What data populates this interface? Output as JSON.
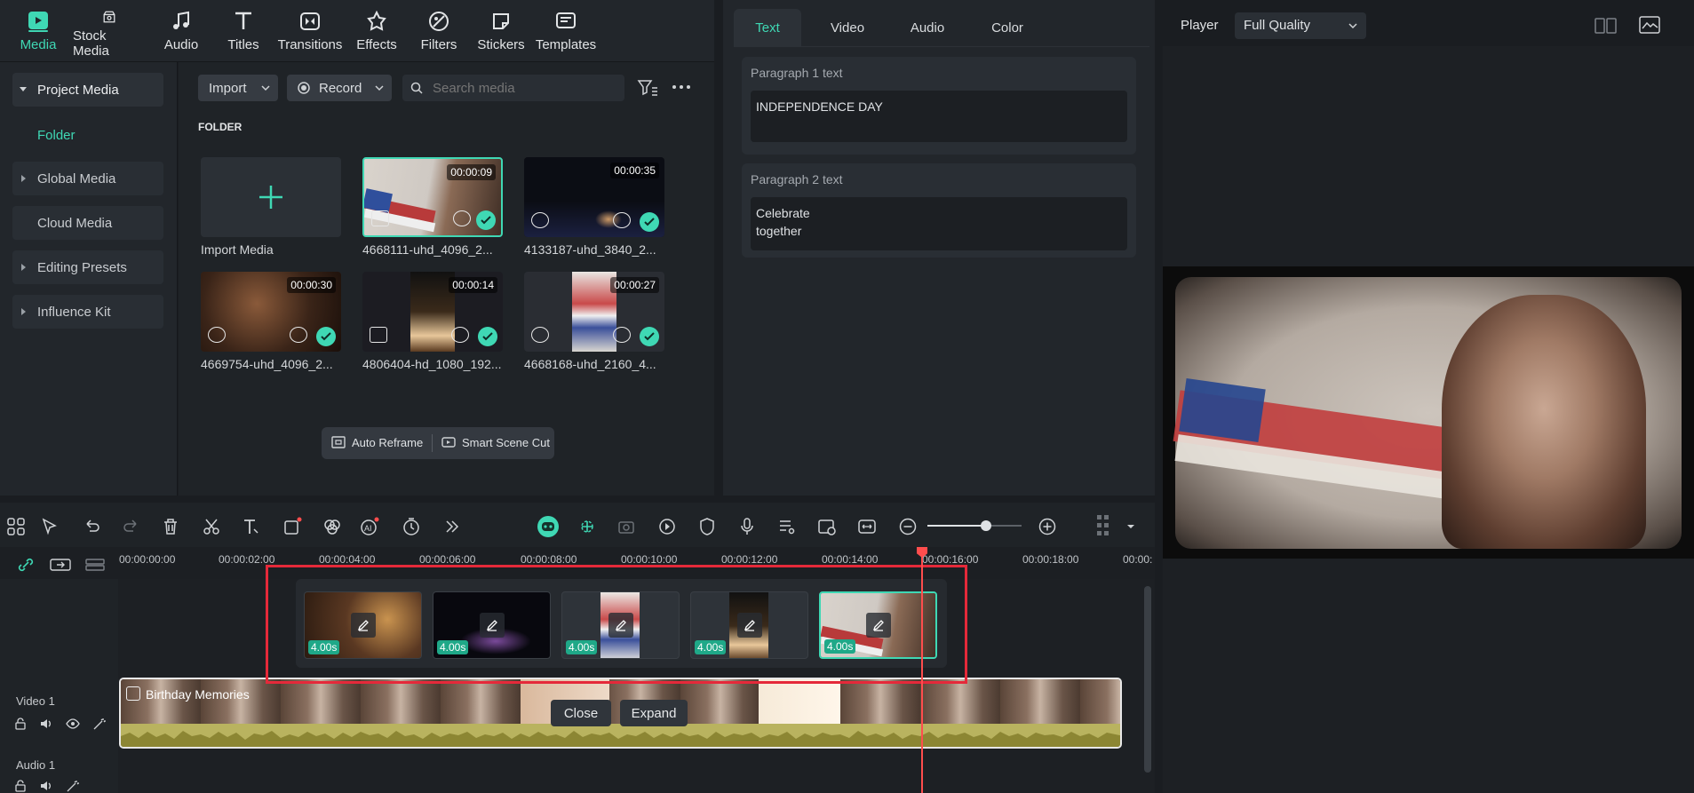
{
  "top_tabs": [
    {
      "label": "Media",
      "icon": "media-icon"
    },
    {
      "label": "Stock Media",
      "icon": "stock-media-icon"
    },
    {
      "label": "Audio",
      "icon": "music-note-icon"
    },
    {
      "label": "Titles",
      "icon": "titles-icon"
    },
    {
      "label": "Transitions",
      "icon": "transitions-icon"
    },
    {
      "label": "Effects",
      "icon": "effects-icon"
    },
    {
      "label": "Filters",
      "icon": "filters-icon"
    },
    {
      "label": "Stickers",
      "icon": "stickers-icon"
    },
    {
      "label": "Templates",
      "icon": "templates-icon"
    }
  ],
  "left_nav": {
    "project_media": "Project Media",
    "folder": "Folder",
    "global_media": "Global Media",
    "cloud_media": "Cloud Media",
    "editing_presets": "Editing Presets",
    "influence_kit": "Influence Kit"
  },
  "media_toolbar": {
    "import_label": "Import",
    "record_label": "Record",
    "search_placeholder": "Search media"
  },
  "folder_heading": "FOLDER",
  "import_media_label": "Import Media",
  "media_items": [
    {
      "name": "4668111-uhd_4096_2...",
      "duration": "00:00:09"
    },
    {
      "name": "4133187-uhd_3840_2...",
      "duration": "00:00:35"
    },
    {
      "name": "4669754-uhd_4096_2...",
      "duration": "00:00:30"
    },
    {
      "name": "4806404-hd_1080_192...",
      "duration": "00:00:14"
    },
    {
      "name": "4668168-uhd_2160_4...",
      "duration": "00:00:27"
    }
  ],
  "bottom_actions": {
    "auto_reframe": "Auto Reframe",
    "smart_scene_cut": "Smart Scene Cut"
  },
  "property_tabs": [
    "Text",
    "Video",
    "Audio",
    "Color"
  ],
  "paragraphs": [
    {
      "label": "Paragraph 1 text",
      "value": "INDEPENDENCE DAY"
    },
    {
      "label": "Paragraph 2 text",
      "value": "Celebrate\ntogether"
    }
  ],
  "player": {
    "label": "Player",
    "quality": "Full Quality"
  },
  "ruler_ticks": [
    "00:00:00:00",
    "00:00:02:00",
    "00:00:04:00",
    "00:00:06:00",
    "00:00:08:00",
    "00:00:10:00",
    "00:00:12:00",
    "00:00:14:00",
    "00:00:16:00",
    "00:00:18:00",
    "00:00:"
  ],
  "popup_clips": [
    {
      "duration": "4.00s"
    },
    {
      "duration": "4.00s"
    },
    {
      "duration": "4.00s"
    },
    {
      "duration": "4.00s"
    },
    {
      "duration": "4.00s"
    }
  ],
  "tracks": {
    "video1": "Video 1",
    "audio1": "Audio 1",
    "clip_title": "Birthday Memories"
  },
  "timeline_buttons": {
    "close": "Close",
    "expand": "Expand"
  },
  "colors": {
    "accent": "#3fd8b4",
    "playhead": "#ff4d4d",
    "highlight": "#e5293a",
    "waveform": "#c9c36a"
  }
}
